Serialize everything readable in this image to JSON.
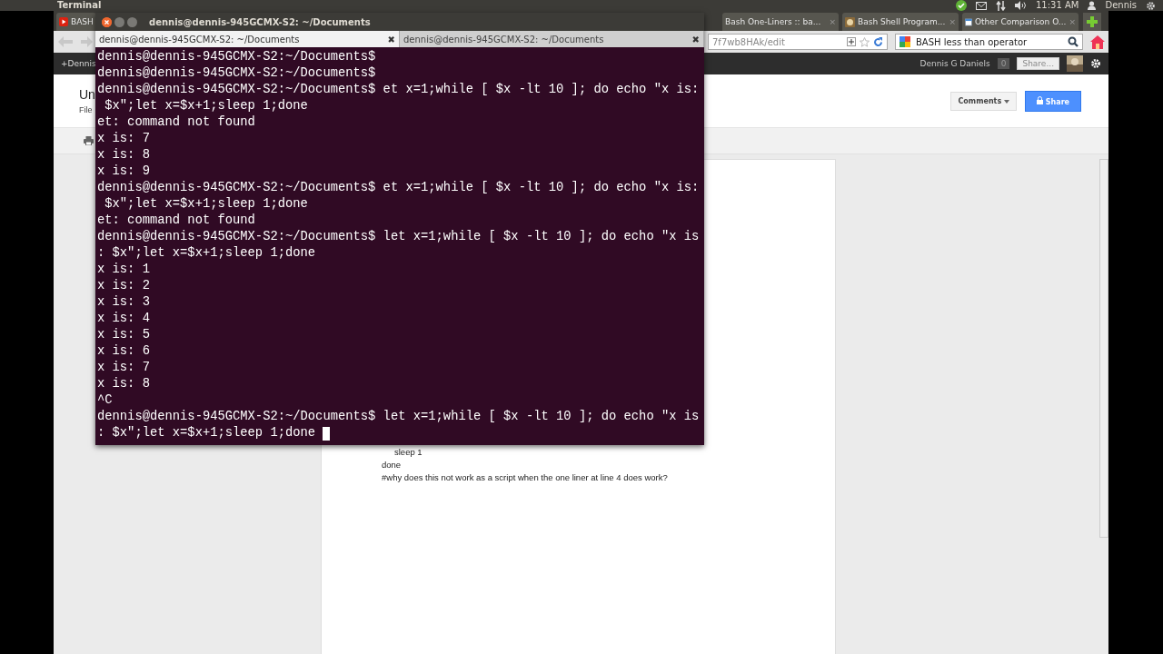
{
  "top_panel": {
    "app_name": "Terminal",
    "clock": "11:31 AM",
    "user": "Dennis"
  },
  "browser": {
    "tabs": [
      {
        "label": "BASH",
        "selected": false,
        "kind": "video"
      },
      {
        "label": "Bash One-Liners :: ba...",
        "selected": false,
        "kind": "plain",
        "close": "×"
      },
      {
        "label": "Bash Shell Program...",
        "selected": false,
        "kind": "face",
        "close": "×"
      },
      {
        "label": "Other Comparison O...",
        "selected": false,
        "kind": "page",
        "close": "×"
      }
    ],
    "url": "7f7wb8HAk/edit",
    "search": "BASH less than operator",
    "google_bar": {
      "left": "+Dennis",
      "user": "Dennis G Daniels",
      "count": "0",
      "share": "Share..."
    },
    "doc": {
      "title": "Un",
      "menu": [
        "File"
      ],
      "comments_button": "Comments",
      "share_button": "Share",
      "lines": [
        "sleep 1",
        "done",
        "#why does this not work as a script when the one liner at line 4 does work?"
      ]
    }
  },
  "terminal": {
    "title": "dennis@dennis-945GCMX-S2: ~/Documents",
    "tabs": [
      {
        "label": "dennis@dennis-945GCMX-S2: ~/Documents",
        "selected": true,
        "close": "✖"
      },
      {
        "label": "dennis@dennis-945GCMX-S2: ~/Documents",
        "selected": false,
        "close": "✖"
      }
    ],
    "lines": [
      "dennis@dennis-945GCMX-S2:~/Documents$",
      "dennis@dennis-945GCMX-S2:~/Documents$",
      "dennis@dennis-945GCMX-S2:~/Documents$ et x=1;while [ $x -lt 10 ]; do echo \"x is:",
      " $x\";let x=$x+1;sleep 1;done",
      "et: command not found",
      "x is: 7",
      "x is: 8",
      "x is: 9",
      "dennis@dennis-945GCMX-S2:~/Documents$ et x=1;while [ $x -lt 10 ]; do echo \"x is:",
      " $x\";let x=$x+1;sleep 1;done",
      "et: command not found",
      "dennis@dennis-945GCMX-S2:~/Documents$ let x=1;while [ $x -lt 10 ]; do echo \"x is",
      ": $x\";let x=$x+1;sleep 1;done",
      "x is: 1",
      "x is: 2",
      "x is: 3",
      "x is: 4",
      "x is: 5",
      "x is: 6",
      "x is: 7",
      "x is: 8",
      "^C",
      "dennis@dennis-945GCMX-S2:~/Documents$ let x=1;while [ $x -lt 10 ]; do echo \"x is",
      ": $x\";let x=$x+1;sleep 1;done "
    ],
    "cursor": true
  }
}
